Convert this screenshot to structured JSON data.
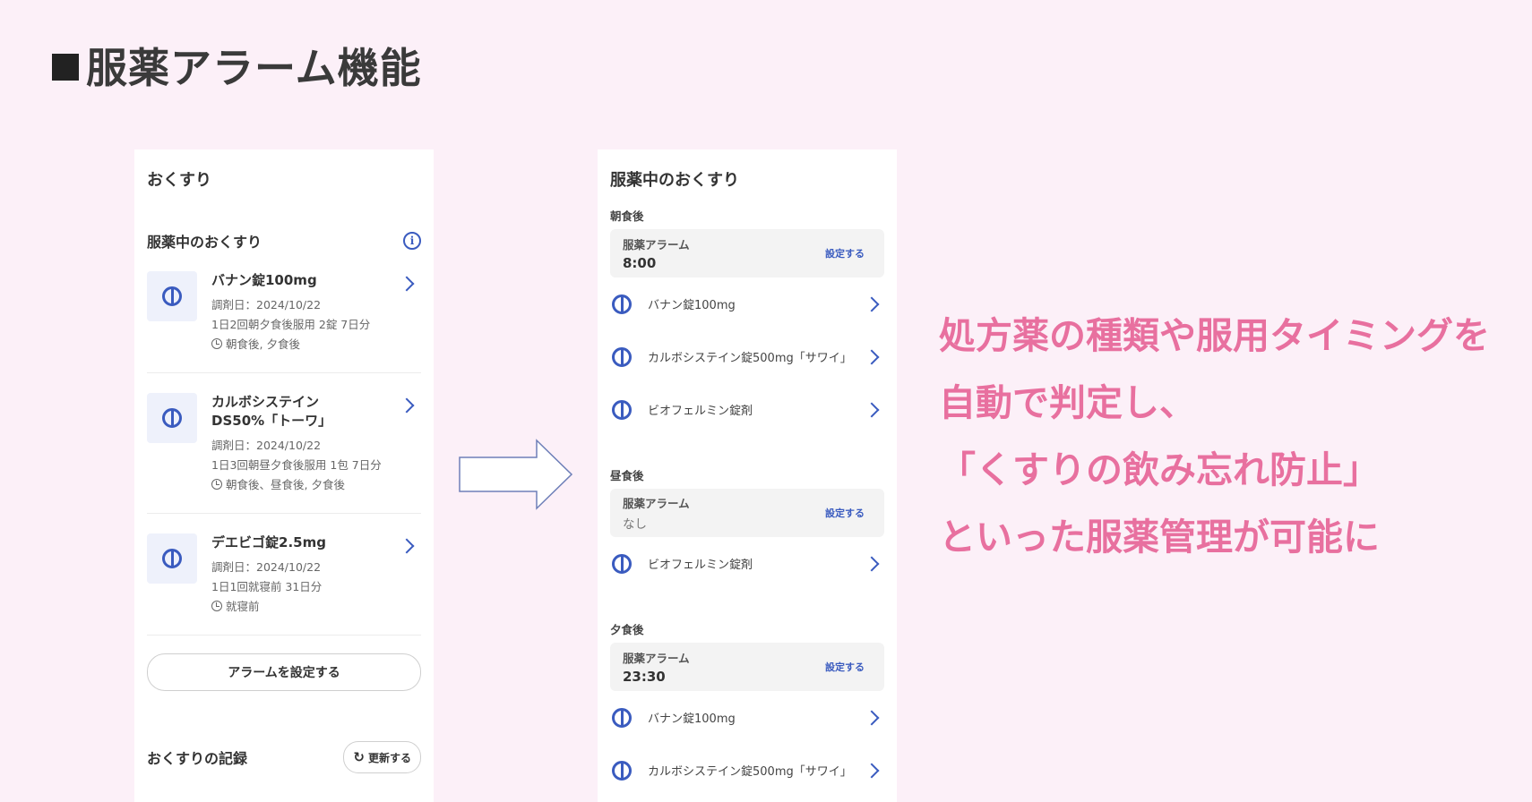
{
  "page": {
    "title": "服薬アラーム機能"
  },
  "left": {
    "title": "おくすり",
    "section_title": "服薬中のおくすり",
    "medications": [
      {
        "name": "バナン錠100mg",
        "date": "調剤日：2024/10/22",
        "dosage": "1日2回朝夕食後服用 2錠 7日分",
        "timing": "朝食後, 夕食後"
      },
      {
        "name": "カルボシステイン\nDS50%「トーワ」",
        "date": "調剤日：2024/10/22",
        "dosage": "1日3回朝昼夕食後服用 1包 7日分",
        "timing": "朝食後、昼食後, 夕食後"
      },
      {
        "name": "デエビゴ錠2.5mg",
        "date": "調剤日：2024/10/22",
        "dosage": "1日1回就寝前 31日分",
        "timing": "就寝前"
      }
    ],
    "alarm_button": "アラームを設定する",
    "records_title": "おくすりの記録",
    "refresh_button": "更新する"
  },
  "right": {
    "title": "服薬中のおくすり",
    "slots": [
      {
        "label": "朝食後",
        "alarm_label": "服薬アラーム",
        "alarm_value": "8:00",
        "alarm_set": "設定する",
        "meds": [
          "バナン錠100mg",
          "カルボシステイン錠500mg「サワイ」",
          "ビオフェルミン錠剤"
        ]
      },
      {
        "label": "昼食後",
        "alarm_label": "服薬アラーム",
        "alarm_value": "なし",
        "alarm_set": "設定する",
        "meds": [
          "ビオフェルミン錠剤"
        ]
      },
      {
        "label": "夕食後",
        "alarm_label": "服薬アラーム",
        "alarm_value": "23:30",
        "alarm_set": "設定する",
        "meds": [
          "バナン錠100mg",
          "カルボシステイン錠500mg「サワイ」"
        ]
      }
    ]
  },
  "description": {
    "lines": [
      "処方薬の種類や服用タイミングを",
      "自動で判定し、",
      "「くすりの飲み忘れ防止」",
      "といった服薬管理が可能に"
    ]
  },
  "colors": {
    "background": "#fcf0f8",
    "accent": "#3a5bbf",
    "highlight": "#e8709f"
  }
}
